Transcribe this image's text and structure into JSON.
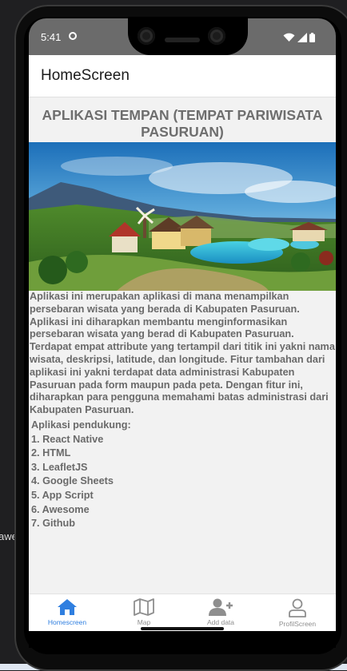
{
  "background": {
    "left_edge_text": "awe"
  },
  "status_bar": {
    "time": "5:41"
  },
  "header": {
    "title": "HomeScreen"
  },
  "main": {
    "title": "APLIKASI TEMPAN (TEMPAT PARIWISATA PASURUAN)",
    "image_alt": "Pasuruan tourism resort with pools, houses and mountains",
    "description": "Aplikasi ini merupakan aplikasi di mana menampilkan persebaran wisata yang berada di Kabupaten Pasuruan. Aplikasi ini diharapkan membantu menginformasikan persebaran wisata yang berad di Kabupaten Pasuruan. Terdapat empat attribute yang tertampil dari titik ini yakni nama wisata, deskripsi, latitude, dan longitude. Fitur tambahan dari aplikasi ini yakni terdapat data administrasi Kabupaten Pasuruan pada form maupun pada peta. Dengan fitur ini, diharapkan para pengguna memahami batas administrasi dari Kabupaten Pasuruan.",
    "support_heading": "Aplikasi pendukung:",
    "support_items": [
      "1. React Native",
      "2. HTML",
      "3. LeafletJS",
      "4. Google Sheets",
      "5. App Script",
      "6. Awesome",
      "7. Github"
    ]
  },
  "tabs": [
    {
      "label": "Homescreen",
      "icon": "home-icon",
      "active": true
    },
    {
      "label": "Map",
      "icon": "map-icon",
      "active": false
    },
    {
      "label": "Add data",
      "icon": "add-user-icon",
      "active": false
    },
    {
      "label": "ProfilScreen",
      "icon": "user-icon",
      "active": false
    }
  ],
  "colors": {
    "accent": "#2f7fe0",
    "inactive": "#8e8e8e",
    "text": "#6a6a6a",
    "app_background": "#f2f2f2"
  }
}
